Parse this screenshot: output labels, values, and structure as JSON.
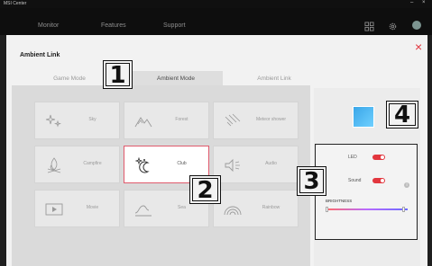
{
  "app": {
    "title": "MSI Center",
    "window_controls": [
      "–",
      "×"
    ]
  },
  "nav": {
    "items": [
      "Monitor",
      "Features",
      "Support"
    ]
  },
  "page": {
    "title": "Ambient Link",
    "close_glyph": "×"
  },
  "tabs": [
    "Game Mode",
    "Ambient Mode",
    "Ambient Link"
  ],
  "modes": [
    {
      "label": "Sky",
      "icon": "sparkles-icon"
    },
    {
      "label": "Forest",
      "icon": "mountains-icon"
    },
    {
      "label": "Meteor shower",
      "icon": "meteor-icon"
    },
    {
      "label": "Campfire",
      "icon": "campfire-icon"
    },
    {
      "label": "Club",
      "icon": "moon-stars-icon"
    },
    {
      "label": "Audio",
      "icon": "speaker-icon"
    },
    {
      "label": "Movie",
      "icon": "play-icon"
    },
    {
      "label": "Sea",
      "icon": "wave-icon"
    },
    {
      "label": "Rainbow",
      "icon": "rainbow-icon"
    }
  ],
  "selected_mode": "Club",
  "settings": {
    "led_label": "LED",
    "led_on": true,
    "sound_label": "Sound",
    "sound_on": true,
    "brightness_label": "BRIGHTNESS",
    "brightness_level": 0.95,
    "info_glyph": "i"
  },
  "callouts": [
    "1",
    "2",
    "3",
    "4"
  ],
  "colors": {
    "accent": "#e2363e",
    "preview_blue": "#3aa6e8",
    "selected_border": "#e05a6c"
  }
}
